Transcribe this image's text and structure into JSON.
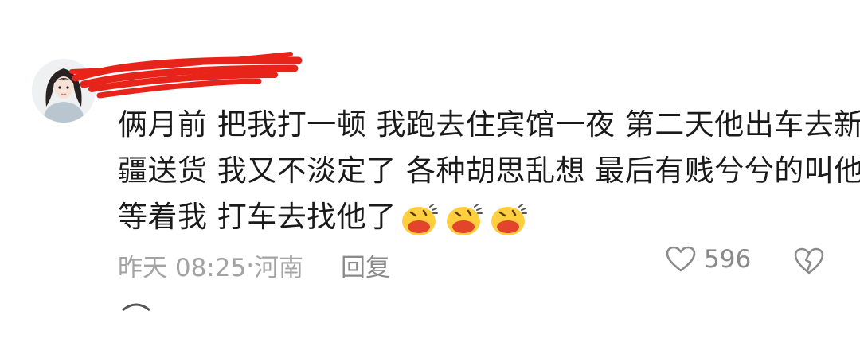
{
  "comment": {
    "lines": [
      "俩月前 把我打一顿 我跑去住宾馆一夜 第二天他出车去新",
      "疆送货 我又不淡定了 各种胡思乱想 最后有贱兮兮的叫他",
      "等着我 打车去找他了"
    ],
    "emoji_names": [
      "laughing-emoji",
      "laughing-emoji",
      "laughing-emoji"
    ],
    "time": "昨天 08:25",
    "separator": "·",
    "location": "河南",
    "reply_label": "回复",
    "like_count": "596"
  },
  "colors": {
    "redaction": "#e8231a",
    "meta_text": "#a3a3a3",
    "action_text": "#8a8a8a"
  }
}
